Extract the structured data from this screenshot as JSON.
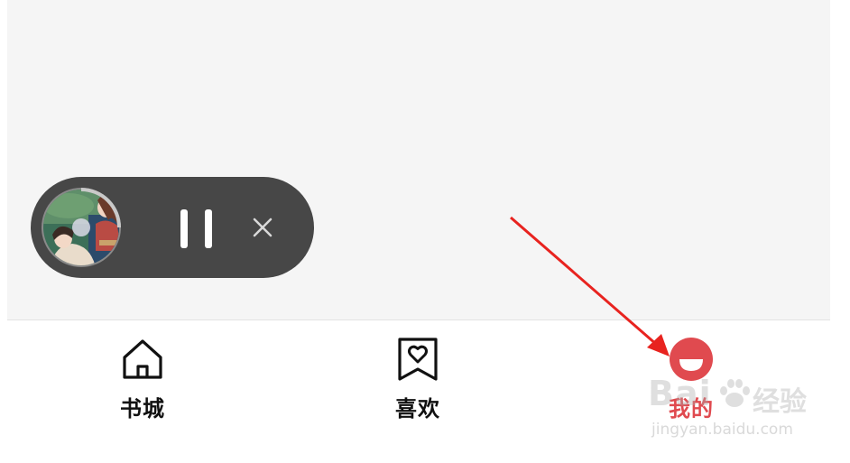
{
  "player": {
    "pause_icon": "pause-icon",
    "close_icon": "close-icon"
  },
  "tabs": [
    {
      "label": "书城",
      "icon": "home-icon",
      "active": false
    },
    {
      "label": "喜欢",
      "icon": "bookmark-heart-icon",
      "active": false
    },
    {
      "label": "我的",
      "icon": "profile-face-icon",
      "active": true
    }
  ],
  "colors": {
    "active_tab": "#e04a4f",
    "annotation_arrow": "#e8231f",
    "player_background": "#474747"
  },
  "watermark": {
    "brand": "Bai",
    "brand_suffix": "经验",
    "url": "jingyan.baidu.com"
  }
}
